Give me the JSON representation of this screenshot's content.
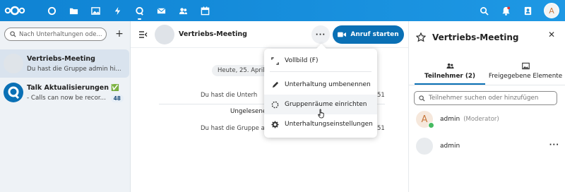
{
  "topbar": {
    "apps": [
      "dashboard",
      "files",
      "photos",
      "activity",
      "talk",
      "mail",
      "contacts",
      "calendar"
    ],
    "user_initial": "A"
  },
  "sidebar": {
    "search_placeholder": "Nach Unterhaltungen suchen",
    "search_visible_text": "Nach Unterhaltungen ode...",
    "conversations": [
      {
        "title": "Vertriebs-Meeting",
        "preview": "Du hast die Gruppe admin hi...",
        "selected": true
      },
      {
        "title": "Talk Aktualisierungen ✅",
        "preview": "- Calls can now be recor...",
        "unread": "48"
      }
    ]
  },
  "chat": {
    "title": "Vertriebs-Meeting",
    "call_button": "Anruf starten",
    "date_pill": "Heute, 25. April",
    "messages": [
      {
        "text": "Du hast die Unterh",
        "time": "51"
      },
      {
        "text": "Du hast die Gruppe a",
        "time": "51"
      }
    ],
    "unread_label": "Ungelesene"
  },
  "menu": {
    "items": [
      {
        "icon": "fullscreen-icon",
        "label": "Vollbild (F)"
      },
      {
        "icon": "pencil-icon",
        "label": "Unterhaltung umbenennen"
      },
      {
        "icon": "breakout-rooms-icon",
        "label": "Gruppenräume einrichten"
      },
      {
        "icon": "gear-icon",
        "label": "Unterhaltungseinstellungen"
      }
    ]
  },
  "panel": {
    "title": "Vertriebs-Meeting",
    "tabs": [
      {
        "label": "Teilnehmer (2)",
        "active": true
      },
      {
        "label": "Freigegebene Elemente"
      }
    ],
    "search_placeholder": "Teilnehmer suchen oder hinzufügen",
    "participants": [
      {
        "name": "admin",
        "role": "(Moderator)",
        "initial": "A"
      },
      {
        "name": "admin"
      }
    ]
  },
  "colors": {
    "topbar": "#0f83d3",
    "primary": "#0a70b5",
    "online": "#46ba61"
  }
}
